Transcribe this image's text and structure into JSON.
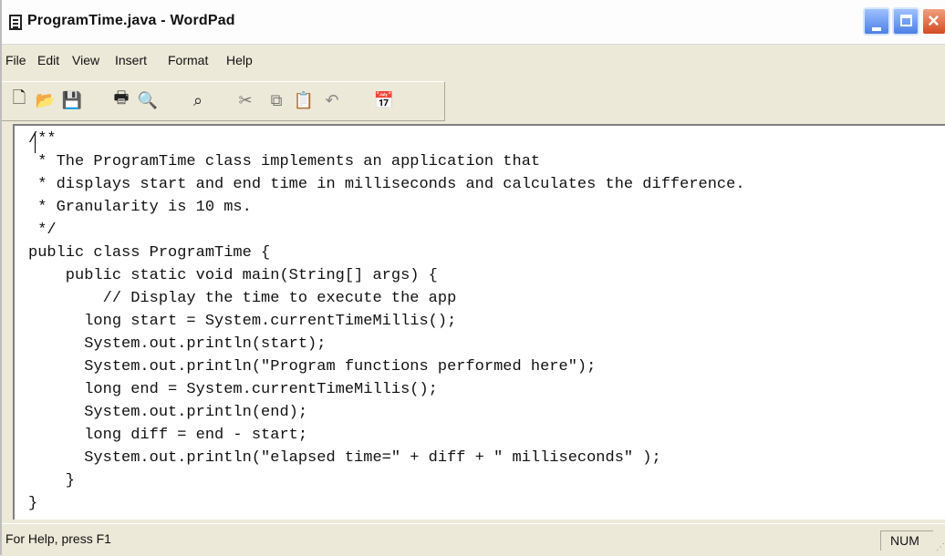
{
  "window": {
    "title": "ProgramTime.java - WordPad"
  },
  "menu": [
    "File",
    "Edit",
    "View",
    "Insert",
    "Format",
    "Help"
  ],
  "toolbar": {
    "icons": [
      "new-icon",
      "open-icon",
      "save-icon",
      "print-icon",
      "print-preview-icon",
      "find-icon",
      "cut-icon",
      "copy-icon",
      "paste-icon",
      "undo-icon",
      "date-time-icon"
    ]
  },
  "document": {
    "lines": [
      "/**",
      " * The ProgramTime class implements an application that",
      " * displays start and end time in milliseconds and calculates the difference.",
      " * Granularity is 10 ms.",
      " */",
      "public class ProgramTime {",
      "    public static void main(String[] args) {",
      "        // Display the time to execute the app",
      "      long start = System.currentTimeMillis();",
      "      System.out.println(start);",
      "      System.out.println(\"Program functions performed here\");",
      "      long end = System.currentTimeMillis();",
      "      System.out.println(end);",
      "      long diff = end - start;",
      "      System.out.println(\"elapsed time=\" + diff + \" milliseconds\" );",
      "    }",
      "}"
    ]
  },
  "status": {
    "help_text": "For Help, press F1",
    "num": "NUM"
  }
}
